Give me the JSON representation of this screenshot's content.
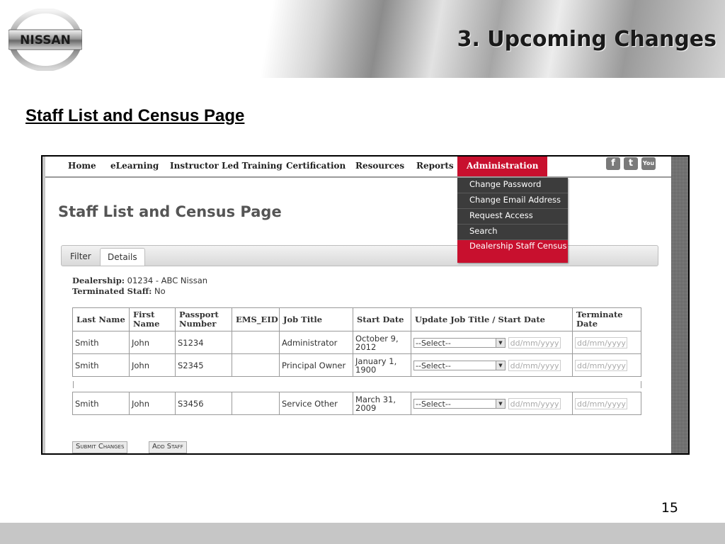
{
  "slide": {
    "title": "3. Upcoming Changes",
    "subtitle": "Staff List and Census Page",
    "page_number": "15",
    "logo_text": "NISSAN"
  },
  "nav": {
    "items": [
      "Home",
      "eLearning",
      "Instructor Led Training",
      "Certification",
      "Resources",
      "Reports",
      "Administration"
    ],
    "active": "Administration",
    "social_icons": [
      "facebook-icon",
      "twitter-icon",
      "youtube-icon"
    ]
  },
  "dropdown": {
    "items": [
      "Change Password",
      "Change Email Address",
      "Request Access",
      "Search",
      "Dealership Staff Census"
    ],
    "active": "Dealership Staff Census"
  },
  "page": {
    "heading": "Staff List and Census Page",
    "tabs": [
      "Filter",
      "Details"
    ],
    "active_tab": "Details",
    "dealership_label": "Dealership:",
    "dealership_value": "01234 - ABC Nissan",
    "terminated_label": "Terminated Staff:",
    "terminated_value": "No"
  },
  "table": {
    "headers": [
      "Last Name",
      "First Name",
      "Passport Number",
      "EMS_EID",
      "Job Title",
      "Start Date",
      "Update Job Title / Start Date",
      "Terminate Date"
    ],
    "select_placeholder": "--Select--",
    "date_placeholder": "dd/mm/yyyy",
    "rows": [
      {
        "last": "Smith",
        "first": "John",
        "passport": "S1234",
        "ems": "",
        "job": "Administrator",
        "start": "October 9, 2012"
      },
      {
        "last": "Smith",
        "first": "John",
        "passport": "S2345",
        "ems": "",
        "job": "Principal Owner",
        "start": "January 1, 1900"
      },
      {
        "last": "Smith",
        "first": "John",
        "passport": "S3456",
        "ems": "",
        "job": "Service Other",
        "start": "March 31, 2009"
      }
    ]
  },
  "buttons": {
    "submit": "Submit Changes",
    "add": "Add Staff"
  },
  "colors": {
    "accent": "#c8102e",
    "dropdown_bg": "#3c3c3c"
  }
}
